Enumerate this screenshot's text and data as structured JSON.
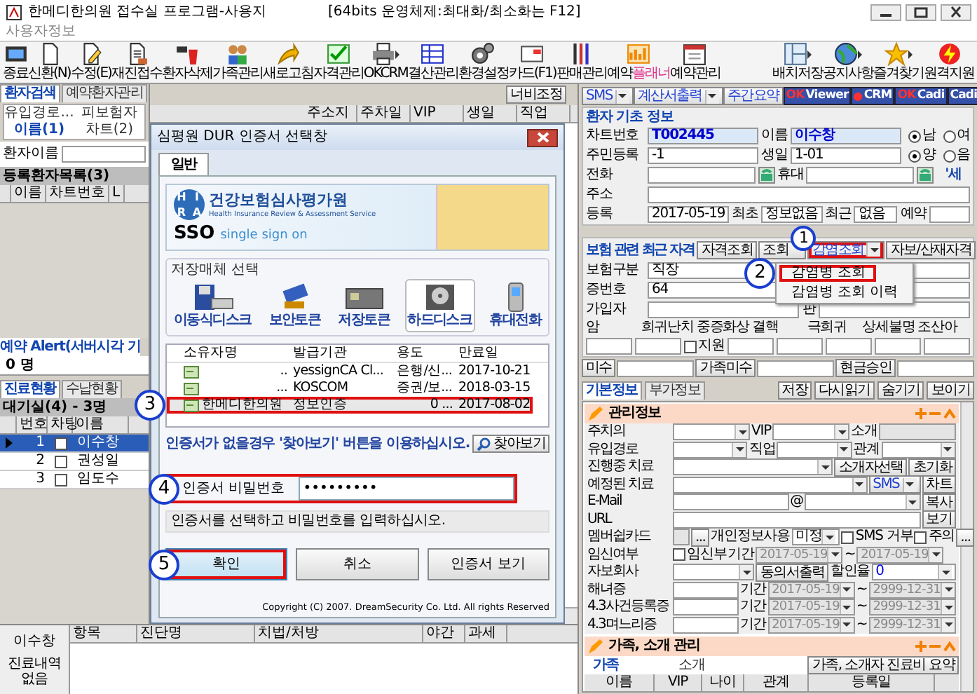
{
  "window": {
    "title": "한메디한의원 접수실 프로그램-사용지",
    "subtitle": "[64bits 운영체제:최대화/최소화는 F12]"
  },
  "menu": [
    "사용자정보"
  ],
  "toolbar_left": [
    {
      "label": "종료",
      "dropdown": false
    },
    {
      "label": "신환(N)",
      "dropdown": false
    },
    {
      "label": "수정(E)",
      "dropdown": false
    },
    {
      "label": "재진접수",
      "dropdown": false
    },
    {
      "label": "환자삭제",
      "dropdown": false
    },
    {
      "label": "가족관리",
      "dropdown": false
    },
    {
      "label": "새로고침",
      "dropdown": false
    },
    {
      "label": "자격관리",
      "dropdown": false
    },
    {
      "label": "OKCRM",
      "dropdown": true
    },
    {
      "label": "결산관리",
      "dropdown": false
    },
    {
      "label": "환경설정",
      "dropdown": false
    },
    {
      "label": "카드(F1)",
      "dropdown": false
    },
    {
      "label": "판매관리",
      "dropdown": false
    },
    {
      "label": "예약",
      "accent": "플래너",
      "dropdown": false
    },
    {
      "label": "예약관리",
      "dropdown": false
    }
  ],
  "toolbar_right": [
    {
      "label": "배치저장",
      "dropdown": true
    },
    {
      "label": "공지사항",
      "dropdown": true
    },
    {
      "label": "즐겨찾기",
      "dropdown": true
    },
    {
      "label": "원격지원",
      "dropdown": false
    }
  ],
  "left_panel": {
    "tabs": [
      {
        "label": "환자검색",
        "selected": true
      },
      {
        "label": "예약환자관리",
        "selected": false
      }
    ],
    "search_tabs": [
      {
        "label": "유입경로...",
        "selected": false
      },
      {
        "label": "피보험자",
        "selected": false
      },
      {
        "label": "이름(1)",
        "selected": true
      },
      {
        "label": "차트(2)",
        "selected": false
      }
    ],
    "name_label": "환자이름",
    "patient_list": {
      "title": "등록환자목록(3)",
      "columns": [
        "이름",
        "차트번호",
        "L"
      ]
    },
    "alert": "예약 Alert(서버시각 기",
    "alert_count": "0 명",
    "status_tabs": [
      {
        "label": "진료현황",
        "selected": true
      },
      {
        "label": "수납현황",
        "selected": false
      }
    ],
    "waiting": {
      "title": "대기실(4) - 3명",
      "columns": [
        "번호",
        "차팅",
        "이름"
      ],
      "rows": [
        {
          "no": "1",
          "charted": false,
          "name": "이수창",
          "selected": true
        },
        {
          "no": "2",
          "charted": false,
          "name": "권성일",
          "selected": false
        },
        {
          "no": "3",
          "charted": false,
          "name": "임도수",
          "selected": false
        }
      ]
    },
    "history": {
      "patient": "이수창",
      "note": "진료내역 없음"
    }
  },
  "middle": {
    "width_button": "너비조정",
    "columns": [
      "주소지",
      "주차일",
      "VIP",
      "생일",
      "직업"
    ],
    "bottom_columns": [
      "항목",
      "진단명",
      "치법/처방",
      "야간",
      "과세"
    ]
  },
  "dialog": {
    "title": "심평원 DUR 인증서 선택창",
    "tab": "일반",
    "banner": {
      "logo_letters": [
        "H",
        "I",
        "R",
        "A"
      ],
      "org": "건강보험심사평가원",
      "org_en": "Health Insurance Review & Assessment Service",
      "sso": "SSO",
      "sso_text": "single sign on"
    },
    "media_title": "저장매체 선택",
    "media": [
      {
        "label": "이동식디스크",
        "selected": false
      },
      {
        "label": "보안토큰",
        "selected": false
      },
      {
        "label": "저장토큰",
        "selected": false
      },
      {
        "label": "하드디스크",
        "selected": true
      },
      {
        "label": "휴대전화",
        "selected": false
      }
    ],
    "columns": [
      "소유자명",
      "발급기관",
      "용도",
      "만료일"
    ],
    "certs": [
      {
        "owner": "..",
        "issuer": "yessignCA Cl...",
        "usage": "은행/신...",
        "expires": "2017-10-21",
        "selected": false,
        "highlighted": false
      },
      {
        "owner": "...",
        "issuer": "KOSCOM",
        "usage": "증권/보...",
        "expires": "2018-03-15",
        "selected": false,
        "highlighted": false
      },
      {
        "owner": "한메디한의원",
        "issuer": "정보인증",
        "usage": "0 ...",
        "expires": "2017-08-02",
        "selected": true,
        "highlighted": true,
        "callout": "3"
      }
    ],
    "note": "인증서가 없을경우 '찾아보기' 버튼을 이용하십시오.",
    "browse": "찾아보기",
    "password": {
      "label": "인증서 비밀번호",
      "value": "•••••••••",
      "highlighted": true,
      "callout": "4"
    },
    "status": "인증서를 선택하고 비밀번호를 입력하십시오.",
    "buttons": [
      {
        "label": "확인",
        "highlighted": true,
        "callout": "5"
      },
      {
        "label": "취소",
        "highlighted": false
      },
      {
        "label": "인증서 보기",
        "highlighted": false
      }
    ],
    "copyright": "Copyright (C) 2007. DreamSecurity Co. Ltd. All rights Reserved"
  },
  "right_panel": {
    "top_buttons": [
      {
        "kind": "plain",
        "label": "SMS",
        "dropdown": true
      },
      {
        "kind": "plain",
        "label": "계산서출력",
        "dropdown": true
      },
      {
        "kind": "plain",
        "label": "주간요약",
        "dropdown": false
      },
      {
        "kind": "brand",
        "prefix": "OK",
        "label": "Viewer"
      },
      {
        "kind": "dot",
        "label": "CRM"
      },
      {
        "kind": "brand",
        "prefix": "OK",
        "label": "Cadi"
      },
      {
        "kind": "brand",
        "label": "Cadi"
      }
    ],
    "basic_info": {
      "title": "환자 기초 정보",
      "lines": [
        {
          "items": [
            {
              "kind": "label",
              "text": "차트번호"
            },
            {
              "kind": "field",
              "value": "T002445",
              "emphasis": true
            },
            {
              "kind": "label",
              "text": "이름"
            },
            {
              "kind": "field",
              "value": "이수창",
              "emphasis": true
            },
            {
              "kind": "radio",
              "text": "남",
              "selected": true
            },
            {
              "kind": "radio",
              "text": "여",
              "selected": false
            }
          ]
        },
        {
          "items": [
            {
              "kind": "label",
              "text": "주민등록"
            },
            {
              "kind": "field",
              "value": "-1"
            },
            {
              "kind": "label",
              "text": "생일"
            },
            {
              "kind": "field",
              "value": "1-01"
            },
            {
              "kind": "radio",
              "text": "양",
              "selected": true
            },
            {
              "kind": "radio",
              "text": "음",
              "selected": false
            }
          ]
        },
        {
          "items": [
            {
              "kind": "label",
              "text": "전화"
            },
            {
              "kind": "field"
            },
            {
              "kind": "phone"
            },
            {
              "kind": "label",
              "text": "휴대"
            },
            {
              "kind": "field"
            },
            {
              "kind": "phone"
            },
            {
              "kind": "note",
              "text": "'세"
            }
          ]
        },
        {
          "items": [
            {
              "kind": "label",
              "text": "주소"
            },
            {
              "kind": "field"
            }
          ]
        },
        {
          "items": [
            {
              "kind": "label",
              "text": "등록"
            },
            {
              "kind": "field",
              "value": "2017-05-19"
            },
            {
              "kind": "label",
              "text": "최초"
            },
            {
              "kind": "field",
              "value": "정보없음"
            },
            {
              "kind": "label",
              "text": "최근"
            },
            {
              "kind": "field",
              "value": "없음"
            },
            {
              "kind": "label",
              "text": "예약"
            },
            {
              "kind": "field"
            }
          ]
        }
      ]
    },
    "insurance": {
      "title": "보험 관련 최근 자격",
      "buttons": [
        {
          "label": "자격조회",
          "dropdown": false,
          "highlighted": false
        },
        {
          "label": "조회",
          "dropdown": false,
          "highlighted": false
        },
        {
          "label": "감염조회",
          "dropdown": true,
          "highlighted": true,
          "callout": "1"
        },
        {
          "label": "자보/산재자격",
          "dropdown": false,
          "highlighted": false
        }
      ],
      "menu": [
        {
          "label": "감염병 조회",
          "highlighted": true,
          "callout": "2"
        },
        {
          "label": "감염병 조회 이력",
          "highlighted": false
        }
      ],
      "lines": [
        {
          "items": [
            {
              "kind": "label",
              "text": "보험구분"
            },
            {
              "kind": "field",
              "value": "직장"
            }
          ]
        },
        {
          "items": [
            {
              "kind": "label",
              "text": "증번호"
            },
            {
              "kind": "field",
              "value": "64"
            }
          ]
        },
        {
          "items": [
            {
              "kind": "label",
              "text": "가입자"
            },
            {
              "kind": "field"
            },
            {
              "kind": "label",
              "text": "판"
            },
            {
              "kind": "field"
            }
          ]
        }
      ],
      "conditions": [
        "암",
        "희귀난치",
        "중증화상",
        "결핵",
        "극희귀",
        "상세불명",
        "조산아"
      ],
      "support": {
        "label": "지원",
        "checked": false
      }
    },
    "money": [
      "미수",
      "가족미수",
      "현금승인"
    ],
    "info_tabs": [
      {
        "label": "기본정보",
        "selected": true
      },
      {
        "label": "부가정보",
        "selected": false
      }
    ],
    "info_actions": [
      "저장",
      "다시읽기",
      "숨기기",
      "보이기"
    ],
    "management": {
      "title": "관리정보",
      "lines": [
        {
          "items": [
            {
              "kind": "label",
              "text": "주치의"
            },
            {
              "kind": "select"
            },
            {
              "kind": "label",
              "text": "VIP"
            },
            {
              "kind": "select"
            },
            {
              "kind": "label",
              "text": "소개"
            },
            {
              "kind": "field",
              "disabled": true
            }
          ]
        },
        {
          "items": [
            {
              "kind": "label",
              "text": "유입경로"
            },
            {
              "kind": "select"
            },
            {
              "kind": "label",
              "text": "직업"
            },
            {
              "kind": "select"
            },
            {
              "kind": "label",
              "text": "관계"
            },
            {
              "kind": "select"
            }
          ]
        },
        {
          "items": [
            {
              "kind": "label",
              "text": "진행중 치료"
            },
            {
              "kind": "select"
            },
            {
              "kind": "button",
              "text": "소개자선택"
            },
            {
              "kind": "button",
              "text": "초기화"
            }
          ]
        },
        {
          "items": [
            {
              "kind": "label",
              "text": "예정된 치료"
            },
            {
              "kind": "select"
            },
            {
              "kind": "button",
              "text": "SMS",
              "dropdown": true,
              "accent": true
            },
            {
              "kind": "button",
              "text": "차트"
            }
          ]
        },
        {
          "items": [
            {
              "kind": "label",
              "text": "E-Mail"
            },
            {
              "kind": "field"
            },
            {
              "kind": "label",
              "text": "@"
            },
            {
              "kind": "select"
            },
            {
              "kind": "button",
              "text": "복사"
            }
          ]
        },
        {
          "items": [
            {
              "kind": "label",
              "text": "URL"
            },
            {
              "kind": "field"
            },
            {
              "kind": "button",
              "text": "보기"
            }
          ]
        },
        {
          "items": [
            {
              "kind": "label",
              "text": "멤버쉽카드"
            },
            {
              "kind": "field",
              "disabled": true
            },
            {
              "kind": "button",
              "text": "..."
            },
            {
              "kind": "label",
              "text": "개인정보사용"
            },
            {
              "kind": "select",
              "value": "미정"
            },
            {
              "kind": "check",
              "text": "SMS 거부",
              "checked": false
            },
            {
              "kind": "check",
              "text": "주의",
              "checked": false
            },
            {
              "kind": "button",
              "text": "..."
            }
          ]
        },
        {
          "items": [
            {
              "kind": "label",
              "text": "임신여부"
            },
            {
              "kind": "check",
              "text": "임신부",
              "checked": false
            },
            {
              "kind": "label",
              "text": "기간"
            },
            {
              "kind": "date",
              "value": "2017-05-19"
            },
            {
              "kind": "label",
              "text": "~"
            },
            {
              "kind": "date",
              "value": "2017-05-19"
            }
          ]
        },
        {
          "items": [
            {
              "kind": "label",
              "text": "자보회사"
            },
            {
              "kind": "select"
            },
            {
              "kind": "button",
              "text": "동의서출력"
            },
            {
              "kind": "label",
              "text": "할인율"
            },
            {
              "kind": "select",
              "value": "0",
              "accent": true
            }
          ]
        },
        {
          "items": [
            {
              "kind": "label",
              "text": "해녀증"
            },
            {
              "kind": "field"
            },
            {
              "kind": "label",
              "text": "기간"
            },
            {
              "kind": "date",
              "value": "2017-05-19"
            },
            {
              "kind": "label",
              "text": "~"
            },
            {
              "kind": "date",
              "value": "2999-12-31"
            }
          ]
        },
        {
          "items": [
            {
              "kind": "label",
              "text": "4.3사건등록증"
            },
            {
              "kind": "field"
            },
            {
              "kind": "label",
              "text": "기간"
            },
            {
              "kind": "date",
              "value": "2017-05-19"
            },
            {
              "kind": "label",
              "text": "~"
            },
            {
              "kind": "date",
              "value": "2999-12-31"
            }
          ]
        },
        {
          "items": [
            {
              "kind": "label",
              "text": "4.3며느리증"
            },
            {
              "kind": "field"
            },
            {
              "kind": "label",
              "text": "기간"
            },
            {
              "kind": "date",
              "value": "2017-05-19"
            },
            {
              "kind": "label",
              "text": "~"
            },
            {
              "kind": "date",
              "value": "2999-12-31"
            }
          ]
        }
      ]
    },
    "family": {
      "title": "가족, 소개 관리",
      "tabs": [
        {
          "label": "가족",
          "selected": true
        },
        {
          "label": "소개",
          "selected": false
        }
      ],
      "summary_button": "가족, 소개자 진료비 요약",
      "columns": [
        "이름",
        "VIP",
        "나이",
        "관계",
        "등록일"
      ]
    }
  }
}
